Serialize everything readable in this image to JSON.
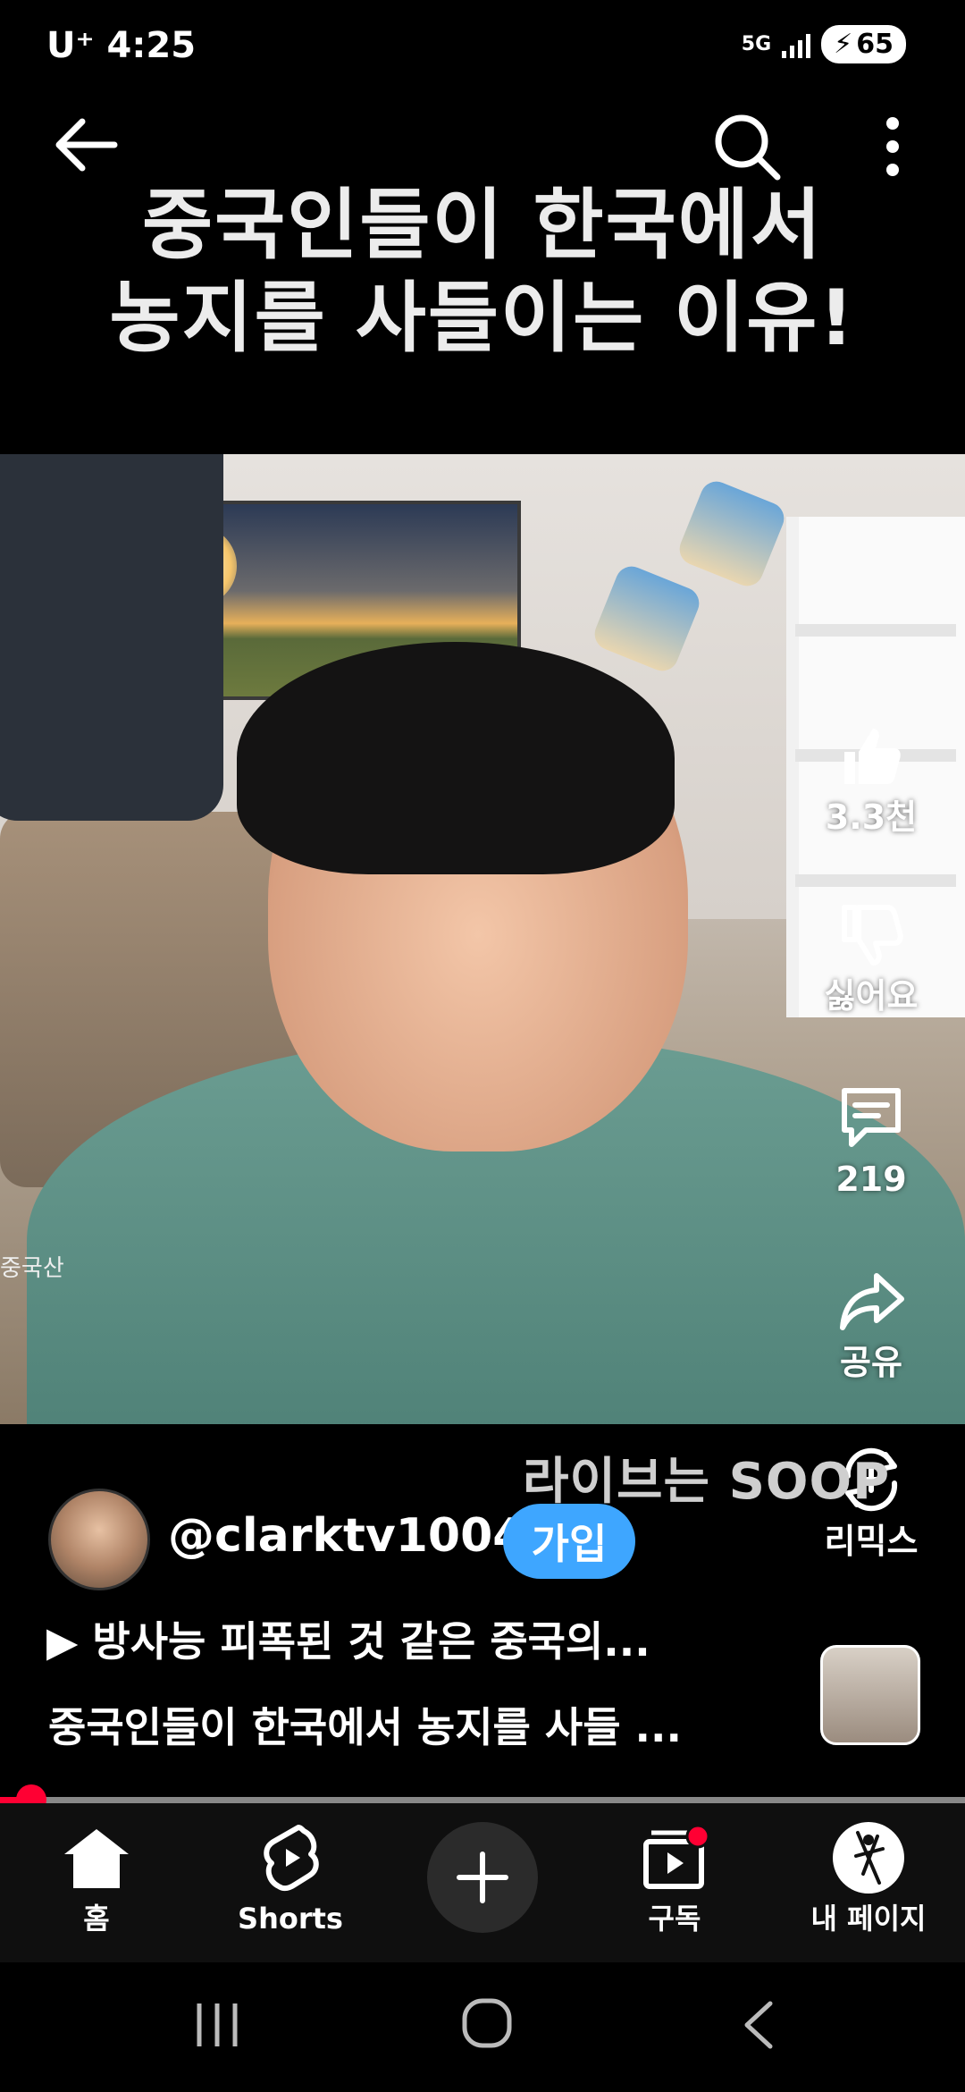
{
  "status_bar": {
    "carrier": "U⁺",
    "time": "4:25",
    "network": "5G",
    "battery": "65"
  },
  "video": {
    "title_line1": "중국인들이 한국에서",
    "title_line2": "농지를 사들이는 이유!",
    "burned_in_text": "중국산",
    "sponsor_watermark": "라이브는 SOOP"
  },
  "actions": {
    "like_count": "3.3천",
    "dislike_label": "싫어요",
    "comment_count": "219",
    "share_label": "공유",
    "remix_label": "리믹스"
  },
  "channel": {
    "handle": "@clarktv1004",
    "join_label": "가입"
  },
  "playlist": {
    "icon": "play-icon",
    "text": "방사능 피폭된 것 같은 중국의..."
  },
  "description": "중국인들이 한국에서 농지를 사들 ...",
  "progress": {
    "fraction": 0.03
  },
  "nav": {
    "home": "홈",
    "shorts": "Shorts",
    "subscriptions": "구독",
    "profile": "내 페이지"
  },
  "colors": {
    "accent_red": "#ff0033",
    "join_blue": "#3ea6ff",
    "background": "#000000"
  }
}
